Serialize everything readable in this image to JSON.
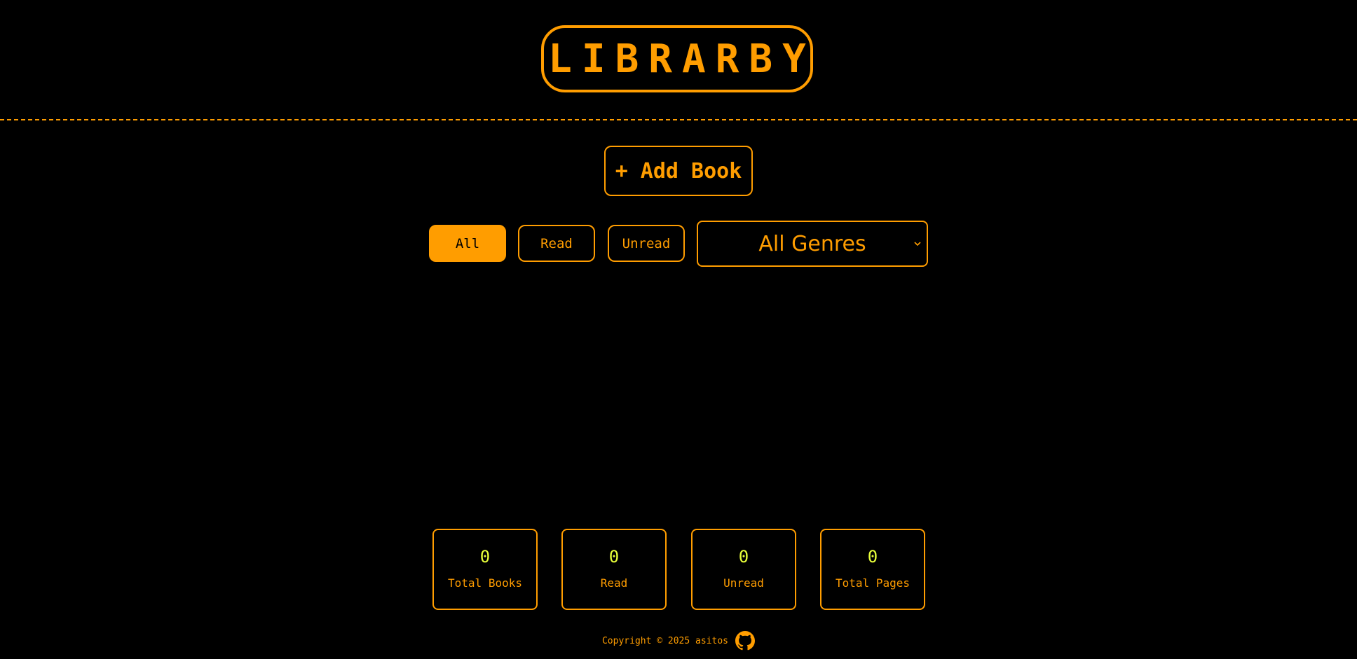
{
  "app": {
    "logo_text": "LIBRARBY",
    "accent_color": "#ff9d00",
    "value_color": "#e8ff3a",
    "background_color": "#000000"
  },
  "actions": {
    "add_book_label": "+ Add Book"
  },
  "filters": {
    "all_label": "All",
    "read_label": "Read",
    "unread_label": "Unread",
    "active": "All"
  },
  "genre_select": {
    "selected": "All Genres"
  },
  "stats": [
    {
      "value": "0",
      "label": "Total Books"
    },
    {
      "value": "0",
      "label": "Read"
    },
    {
      "value": "0",
      "label": "Unread"
    },
    {
      "value": "0",
      "label": "Total Pages"
    }
  ],
  "footer": {
    "text": "Copyright © 2025 asitos",
    "icon": "github-icon"
  }
}
